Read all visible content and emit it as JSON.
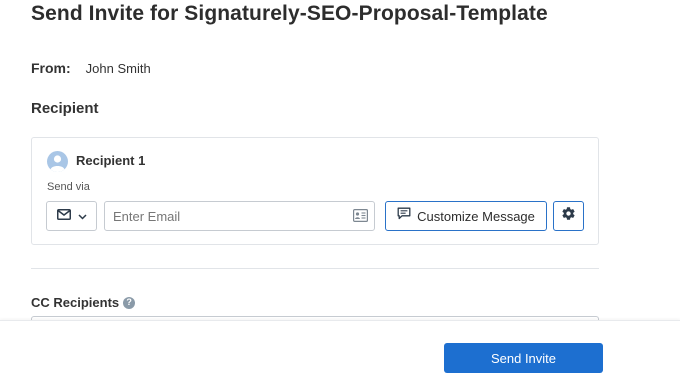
{
  "page": {
    "title": "Send Invite for Signaturely-SEO-Proposal-Template"
  },
  "from": {
    "label": "From:",
    "value": "John Smith"
  },
  "recipient_section": {
    "heading": "Recipient",
    "card": {
      "name": "Recipient 1",
      "send_via_label": "Send via",
      "via_icon": "envelope-icon",
      "email_placeholder": "Enter Email",
      "email_value": "",
      "customize_label": "Customize Message",
      "settings_icon": "gear-icon"
    }
  },
  "cc": {
    "label": "CC Recipients",
    "help_glyph": "?"
  },
  "footer": {
    "send_label": "Send Invite"
  },
  "colors": {
    "accent": "#1d6fd0",
    "outline_accent": "#2a72c8",
    "avatar": "#a9c6e6",
    "border": "#c6cbd1"
  }
}
